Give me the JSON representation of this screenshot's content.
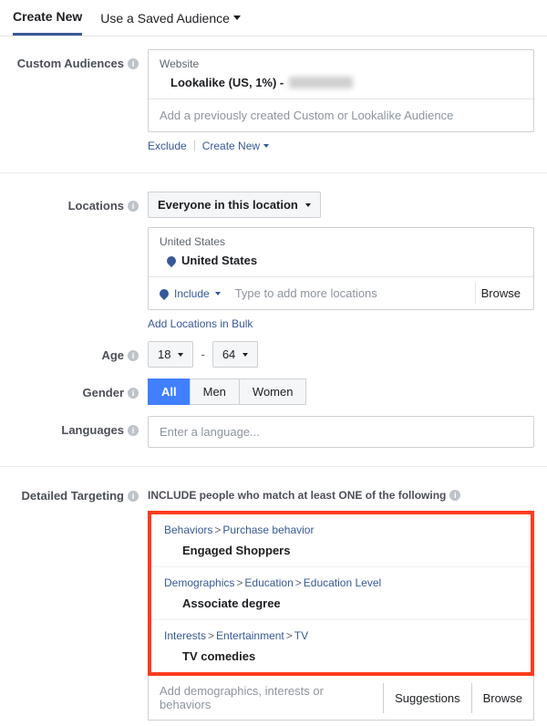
{
  "tabs": {
    "create": "Create New",
    "saved": "Use a Saved Audience"
  },
  "labels": {
    "custom_audiences": "Custom Audiences",
    "locations": "Locations",
    "age": "Age",
    "gender": "Gender",
    "languages": "Languages",
    "detailed_targeting": "Detailed Targeting"
  },
  "custom_audiences": {
    "source": "Website",
    "entry_prefix": "Lookalike (US, 1%) - ",
    "placeholder": "Add a previously created Custom or Lookalike Audience",
    "exclude": "Exclude",
    "create_new": "Create New"
  },
  "locations": {
    "mode": "Everyone in this location",
    "group": "United States",
    "selected": "United States",
    "include": "Include",
    "placeholder": "Type to add more locations",
    "browse": "Browse",
    "bulk": "Add Locations in Bulk"
  },
  "age": {
    "min": "18",
    "max": "64"
  },
  "gender": {
    "all": "All",
    "men": "Men",
    "women": "Women"
  },
  "languages": {
    "placeholder": "Enter a language..."
  },
  "detailed": {
    "title": "INCLUDE people who match at least ONE of the following",
    "items": [
      {
        "path": [
          "Behaviors",
          "Purchase behavior"
        ],
        "value": "Engaged Shoppers"
      },
      {
        "path": [
          "Demographics",
          "Education",
          "Education Level"
        ],
        "value": "Associate degree"
      },
      {
        "path": [
          "Interests",
          "Entertainment",
          "TV"
        ],
        "value": "TV comedies"
      }
    ],
    "placeholder": "Add demographics, interests or behaviors",
    "suggestions": "Suggestions",
    "browse": "Browse"
  }
}
